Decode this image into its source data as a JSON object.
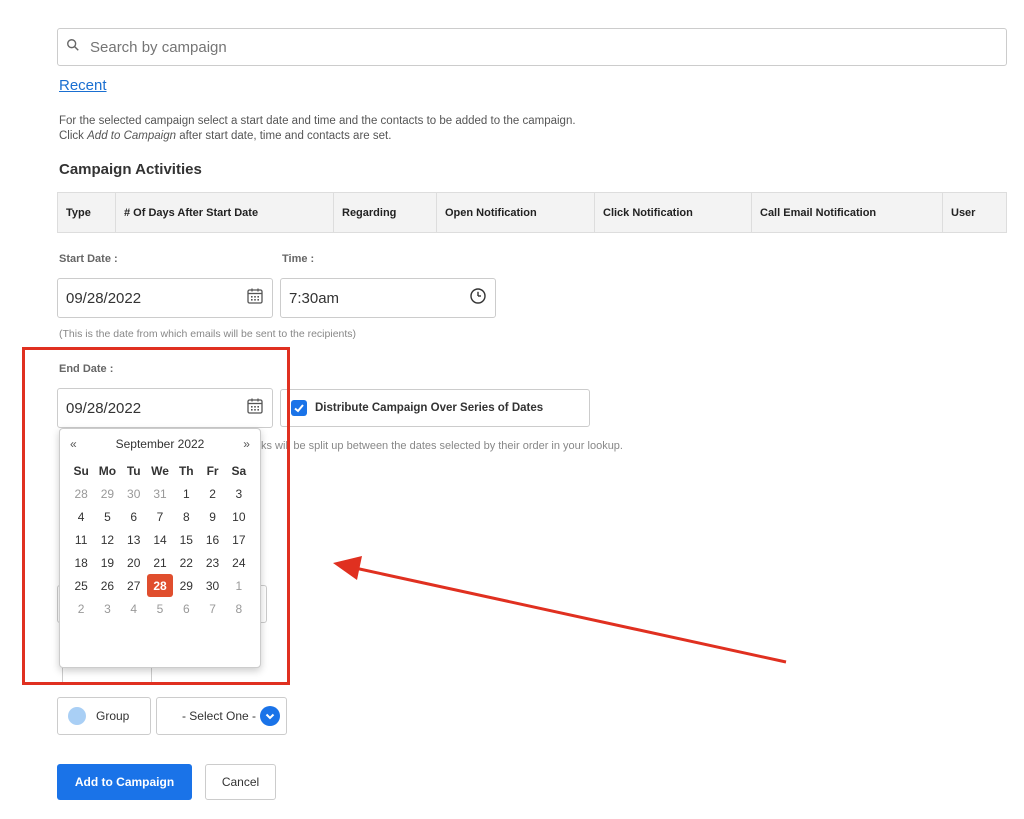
{
  "search": {
    "placeholder": "Search by campaign",
    "icon": "search-icon"
  },
  "recent_link": "Recent",
  "instructions": {
    "line1": "For the selected campaign select a start date and time and the contacts to be added to the campaign.",
    "line2_prefix": "Click ",
    "line2_em": "Add to Campaign",
    "line2_suffix": " after start date, time and contacts are set."
  },
  "activities": {
    "title": "Campaign Activities",
    "columns": [
      "Type",
      "# Of Days After Start Date",
      "Regarding",
      "Open Notification",
      "Click Notification",
      "Call Email Notification",
      "User"
    ]
  },
  "start_date": {
    "label": "Start Date :",
    "value": "09/28/2022",
    "note": "(This is the date from which emails will be sent to the recipients)"
  },
  "time": {
    "label": "Time :",
    "value": "7:30am"
  },
  "end_date": {
    "label": "End Date :",
    "value": "09/28/2022"
  },
  "distribute": {
    "label": "Distribute Campaign Over Series of Dates",
    "checked": true
  },
  "distribute_note_visible": "ks will be split up between the dates selected by their order in your lookup.",
  "calendar": {
    "prev": "«",
    "next": "»",
    "month": "September 2022",
    "weekdays": [
      "Su",
      "Mo",
      "Tu",
      "We",
      "Th",
      "Fr",
      "Sa"
    ],
    "weeks": [
      [
        "28",
        "29",
        "30",
        "31",
        "1",
        "2",
        "3"
      ],
      [
        "4",
        "5",
        "6",
        "7",
        "8",
        "9",
        "10"
      ],
      [
        "11",
        "12",
        "13",
        "14",
        "15",
        "16",
        "17"
      ],
      [
        "18",
        "19",
        "20",
        "21",
        "22",
        "23",
        "24"
      ],
      [
        "25",
        "26",
        "27",
        "28",
        "29",
        "30",
        "1"
      ],
      [
        "2",
        "3",
        "4",
        "5",
        "6",
        "7",
        "8"
      ]
    ],
    "selected": "28",
    "selected_color": "#e04e2e"
  },
  "group": {
    "label": "Group"
  },
  "select_one": {
    "value": "- Select One -"
  },
  "buttons": {
    "add": "Add to Campaign",
    "cancel": "Cancel"
  },
  "colors": {
    "accent": "#1a73e8",
    "annotation": "#e03020",
    "link": "#1a6fd1"
  }
}
